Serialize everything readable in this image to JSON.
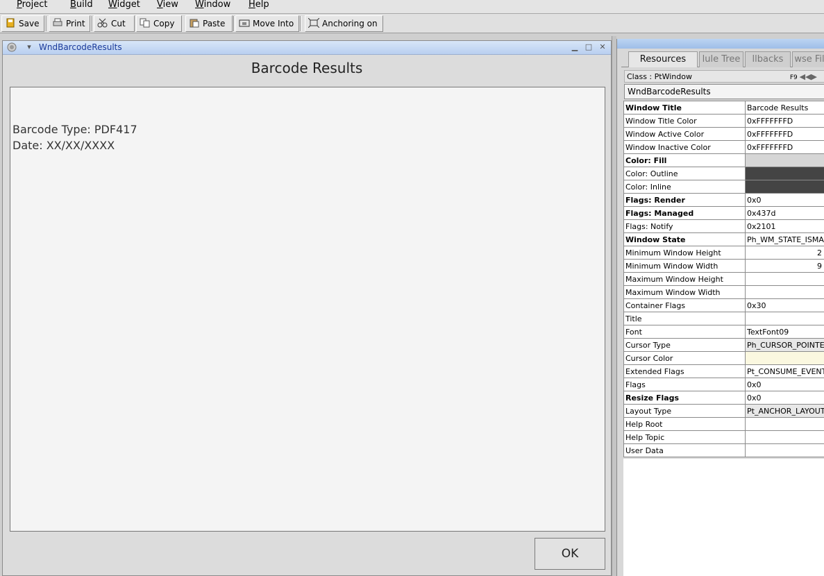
{
  "menubar": {
    "items": [
      "Project",
      "Build",
      "Widget",
      "View",
      "Window",
      "Help"
    ]
  },
  "toolbar": {
    "save": "Save",
    "print": "Print",
    "cut": "Cut",
    "copy": "Copy",
    "paste": "Paste",
    "move_into": "Move Into",
    "anchoring": "Anchoring on"
  },
  "dialog": {
    "window_name": "WndBarcodeResults",
    "heading": "Barcode Results",
    "lines": [
      "Barcode Type: PDF417",
      "Date: XX/XX/XXXX"
    ],
    "ok": "OK"
  },
  "resources_panel": {
    "tabs": [
      "Resources",
      "lule Tree",
      "llbacks",
      "wse Fil"
    ],
    "class_label": "Class : PtWindow",
    "class_shortcut": "F9",
    "widget_name": "WndBarcodeResults",
    "rows": [
      {
        "name": "Window Title",
        "value": "Barcode Results",
        "bold": true
      },
      {
        "name": "Window Title Color",
        "value": "0xFFFFFFFD"
      },
      {
        "name": "Window Active Color",
        "value": "0xFFFFFFFD"
      },
      {
        "name": "Window Inactive Color",
        "value": "0xFFFFFFFD"
      },
      {
        "name": "Color: Fill",
        "value": "",
        "bold": true,
        "swatch": "grey"
      },
      {
        "name": "Color: Outline",
        "value": "",
        "swatch": "dark"
      },
      {
        "name": "Color: Inline",
        "value": "",
        "swatch": "dark"
      },
      {
        "name": "Flags: Render",
        "value": "0x0",
        "bold": true
      },
      {
        "name": "Flags: Managed",
        "value": "0x437d",
        "bold": true
      },
      {
        "name": "Flags: Notify",
        "value": "0x2101"
      },
      {
        "name": "Window State",
        "value": "Ph_WM_STATE_ISMA",
        "bold": true
      },
      {
        "name": "Minimum Window Height",
        "value": "2",
        "align": "right"
      },
      {
        "name": "Minimum Window Width",
        "value": "9",
        "align": "right"
      },
      {
        "name": "Maximum Window Height",
        "value": ""
      },
      {
        "name": "Maximum Window Width",
        "value": ""
      },
      {
        "name": "Container Flags",
        "value": "0x30"
      },
      {
        "name": "Title",
        "value": ""
      },
      {
        "name": "Font",
        "value": "TextFont09"
      },
      {
        "name": "Cursor Type",
        "value": "Ph_CURSOR_POINTE",
        "swatch": "shade"
      },
      {
        "name": "Cursor Color",
        "value": "",
        "swatch": "pale"
      },
      {
        "name": "Extended Flags",
        "value": "Pt_CONSUME_EVENT"
      },
      {
        "name": "Flags",
        "value": "0x0"
      },
      {
        "name": "Resize Flags",
        "value": "0x0",
        "bold": true
      },
      {
        "name": "Layout Type",
        "value": "Pt_ANCHOR_LAYOUT",
        "swatch": "shade"
      },
      {
        "name": "Help Root",
        "value": ""
      },
      {
        "name": "Help Topic",
        "value": ""
      },
      {
        "name": "User Data",
        "value": ""
      }
    ]
  }
}
